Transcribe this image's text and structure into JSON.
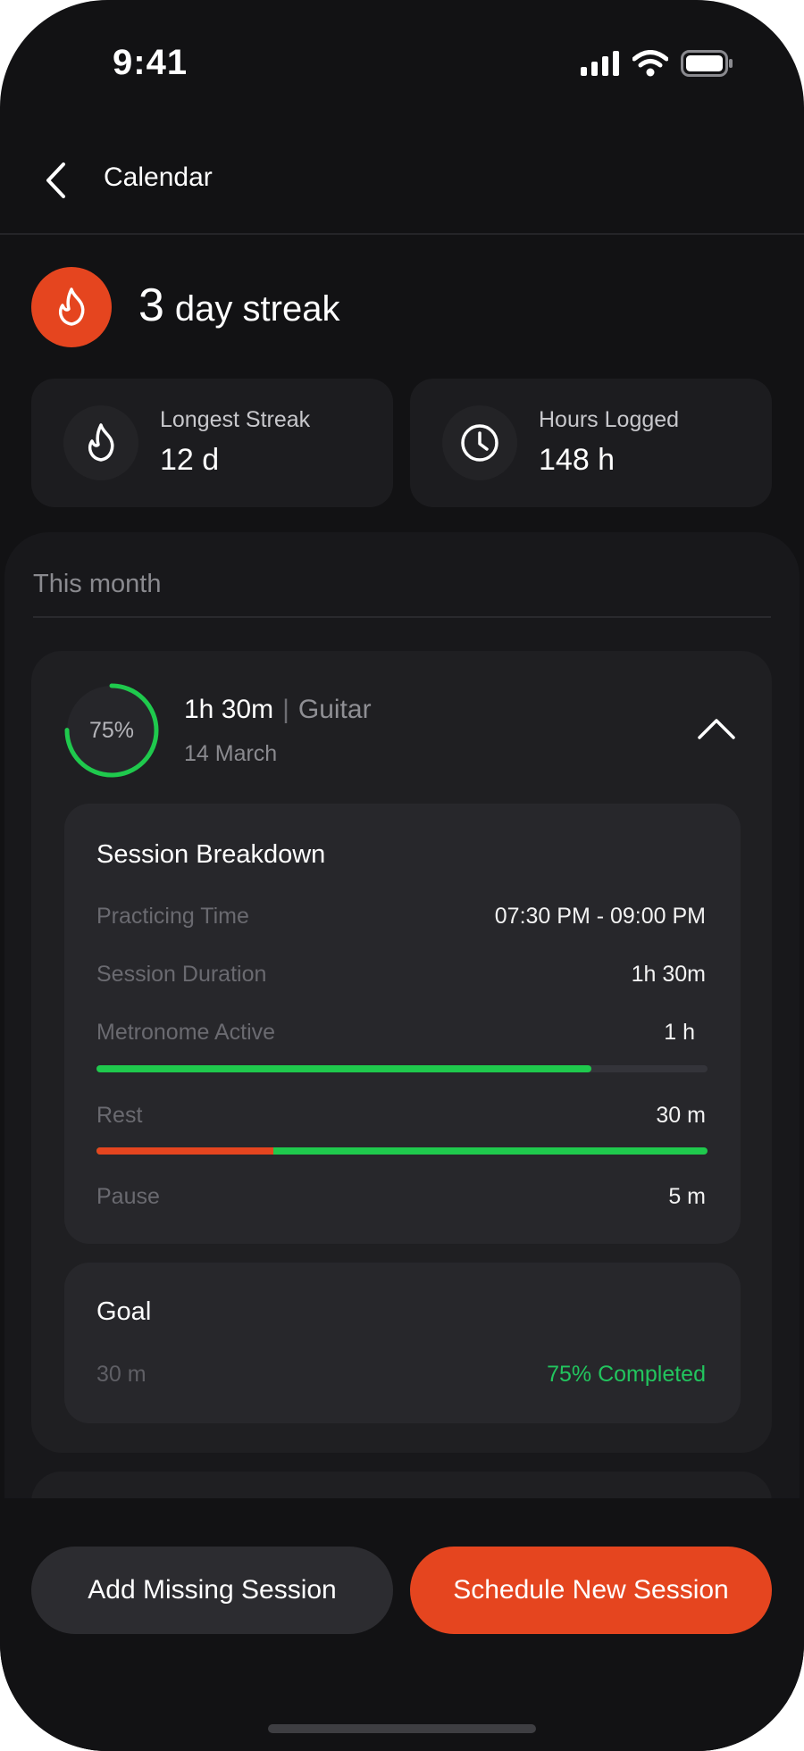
{
  "status_bar": {
    "time": "9:41"
  },
  "header": {
    "title": "Calendar"
  },
  "streak": {
    "count": "3",
    "label": "day streak"
  },
  "stats": [
    {
      "label": "Longest Streak",
      "value": "12 d",
      "icon": "flame-icon"
    },
    {
      "label": "Hours Logged",
      "value": "148 h",
      "icon": "clock-icon"
    }
  ],
  "month": {
    "title": "This month"
  },
  "session": {
    "progress_label": "75%",
    "progress": 0.75,
    "duration": "1h 30m",
    "separator": "|",
    "instrument": "Guitar",
    "date": "14 March",
    "breakdown": {
      "title": "Session Breakdown",
      "practicing_time": {
        "label": "Practicing Time",
        "value": "07:30 PM - 09:00 PM"
      },
      "session_duration": {
        "label": "Session Duration",
        "value": "1h 30m"
      },
      "metronome": {
        "label": "Metronome Active",
        "value": "1 h",
        "fill": 0.81
      },
      "rest": {
        "label": "Rest",
        "value": "30 m",
        "red_fraction": 0.29,
        "green_fraction": 0.71
      },
      "pause": {
        "label": "Pause",
        "value": "5 m"
      }
    },
    "goal": {
      "title": "Goal",
      "target": "30 m",
      "status": "75% Completed"
    }
  },
  "actions": {
    "add_missing": "Add Missing Session",
    "schedule_new": "Schedule New Session"
  },
  "colors": {
    "accent": "#e5451f",
    "success": "#22c55e",
    "background": "#121214"
  }
}
